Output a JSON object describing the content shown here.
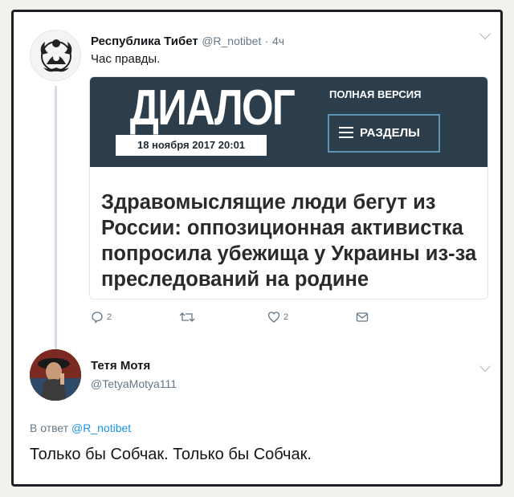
{
  "tweet1": {
    "author_name": "Республика Тибет",
    "handle": "@R_notibet",
    "separator": "·",
    "time": "4ч",
    "text": "Час правды.",
    "card": {
      "logo": "ДИАЛОГ",
      "date": "18 ноября 2017 20:01",
      "full_version": "ПОЛНАЯ ВЕРСИЯ",
      "sections": "РАЗДЕЛЫ",
      "headline": "Здравомыслящие люди бегут из России: оппозиционная активистка попросила убежища у Украины из-за преследований на родине"
    },
    "actions": {
      "replies": "2",
      "likes": "2"
    }
  },
  "tweet2": {
    "author_name": "Тетя Мотя",
    "handle": "@TetyaMotya111",
    "reply_prefix": "В ответ",
    "reply_handle": "@R_notibet",
    "text": "Только бы Собчак. Только бы Собчак."
  },
  "colors": {
    "link": "#1b95e0",
    "muted": "#657786",
    "banner": "#2c3e4c",
    "accent_border": "#5f93b5"
  },
  "icons": [
    "reply-icon",
    "retweet-icon",
    "like-icon",
    "dm-icon",
    "chevron-down-icon"
  ]
}
